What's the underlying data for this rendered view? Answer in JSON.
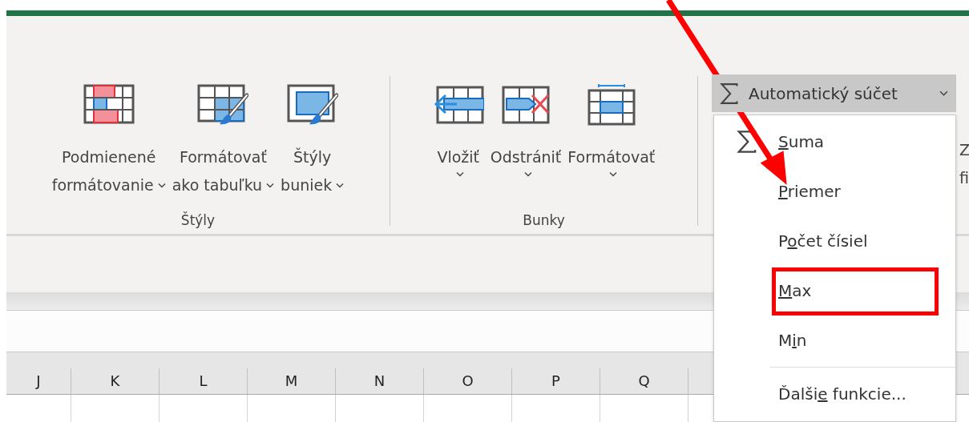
{
  "ribbon": {
    "groups": [
      {
        "label": "Štýly",
        "buttons": [
          {
            "lines": [
              "Podmienené",
              "formátovanie"
            ]
          },
          {
            "lines": [
              "Formátovať",
              "ako tabuľku"
            ]
          },
          {
            "lines": [
              "Štýly",
              "buniek"
            ]
          }
        ]
      },
      {
        "label": "Bunky",
        "buttons": [
          {
            "lines": [
              "Vložiť"
            ]
          },
          {
            "lines": [
              "Odstrániť"
            ]
          },
          {
            "lines": [
              "Formátovať"
            ]
          }
        ]
      }
    ]
  },
  "autosum": {
    "label": "Automatický súčet",
    "expanded": true
  },
  "autosum_menu": {
    "items": [
      {
        "access_key": "S",
        "label_end": "uma",
        "divider_above": false,
        "annotated": false
      },
      {
        "access_key": "P",
        "label_end": "riemer",
        "divider_above": false,
        "annotated": false
      },
      {
        "label_start": "P",
        "access_key": "o",
        "label_end": "čet čísiel",
        "divider_above": false,
        "annotated": false
      },
      {
        "access_key": "M",
        "label_end": "ax",
        "divider_above": false,
        "annotated": true
      },
      {
        "label_start": "M",
        "access_key": "i",
        "label_end": "n",
        "divider_above": false,
        "annotated": false
      },
      {
        "label_start": "Ďalši",
        "access_key": "e",
        "label_end": " funkcie...",
        "divider_above": true,
        "annotated": false
      }
    ]
  },
  "cut_off_text": [
    "Z",
    "fi"
  ],
  "columns": [
    "J",
    "K",
    "L",
    "M",
    "N",
    "O",
    "P",
    "Q"
  ]
}
